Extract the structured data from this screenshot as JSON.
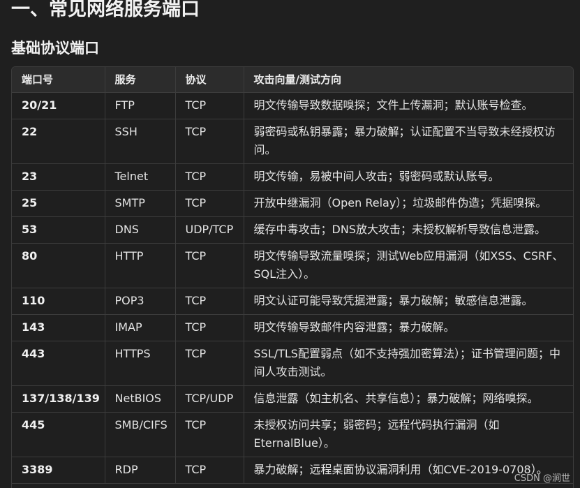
{
  "heading1": "一、常见网络服务端口",
  "heading2": "基础协议端口",
  "table": {
    "headers": [
      "端口号",
      "服务",
      "协议",
      "攻击向量/测试方向"
    ],
    "rows": [
      [
        "20/21",
        "FTP",
        "TCP",
        "明文传输导致数据嗅探；文件上传漏洞；默认账号检查。"
      ],
      [
        "22",
        "SSH",
        "TCP",
        "弱密码或私钥暴露；暴力破解；认证配置不当导致未经授权访问。"
      ],
      [
        "23",
        "Telnet",
        "TCP",
        "明文传输，易被中间人攻击；弱密码或默认账号。"
      ],
      [
        "25",
        "SMTP",
        "TCP",
        "开放中继漏洞（Open Relay）；垃圾邮件伪造；凭据嗅探。"
      ],
      [
        "53",
        "DNS",
        "UDP/TCP",
        "缓存中毒攻击；DNS放大攻击；未授权解析导致信息泄露。"
      ],
      [
        "80",
        "HTTP",
        "TCP",
        "明文传输导致流量嗅探；测试Web应用漏洞（如XSS、CSRF、SQL注入）。"
      ],
      [
        "110",
        "POP3",
        "TCP",
        "明文认证可能导致凭据泄露；暴力破解；敏感信息泄露。"
      ],
      [
        "143",
        "IMAP",
        "TCP",
        "明文传输导致邮件内容泄露；暴力破解。"
      ],
      [
        "443",
        "HTTPS",
        "TCP",
        "SSL/TLS配置弱点（如不支持强加密算法）；证书管理问题；中间人攻击测试。"
      ],
      [
        "137/138/139",
        "NetBIOS",
        "TCP/UDP",
        "信息泄露（如主机名、共享信息）；暴力破解；网络嗅探。"
      ],
      [
        "445",
        "SMB/CIFS",
        "TCP",
        "未授权访问共享；弱密码；远程代码执行漏洞（如EternalBlue）。"
      ],
      [
        "3389",
        "RDP",
        "TCP",
        "暴力破解；远程桌面协议漏洞利用（如CVE-2019-0708）。"
      ]
    ]
  },
  "watermark": "CSDN @涧世"
}
